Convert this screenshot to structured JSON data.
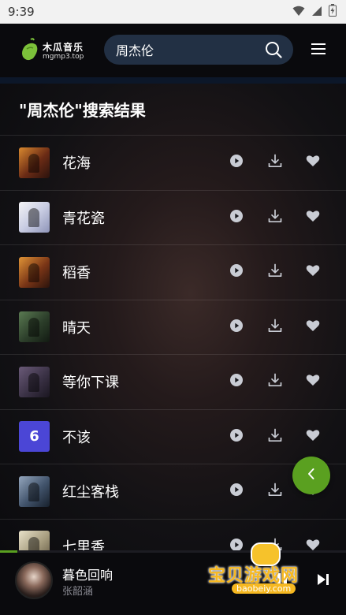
{
  "status": {
    "time": "9:39"
  },
  "header": {
    "logo_name": "木瓜音乐",
    "logo_url": "mgmp3.top",
    "search_value": "周杰伦"
  },
  "page_title": "\"周杰伦\"搜索结果",
  "songs": [
    {
      "name": "花海"
    },
    {
      "name": "青花瓷"
    },
    {
      "name": "稻香"
    },
    {
      "name": "晴天"
    },
    {
      "name": "等你下课"
    },
    {
      "name": "不该",
      "cover_text": "6"
    },
    {
      "name": "红尘客栈"
    },
    {
      "name": "七里香"
    }
  ],
  "player": {
    "title": "暮色回响",
    "artist": "张韶涵",
    "progress": 0.05
  },
  "watermark": {
    "text": "宝贝游戏网",
    "url": "baobeiy.com"
  },
  "colors": {
    "accent": "#5aa020",
    "search_bg": "#223044",
    "icon": "#c9ccd4"
  }
}
